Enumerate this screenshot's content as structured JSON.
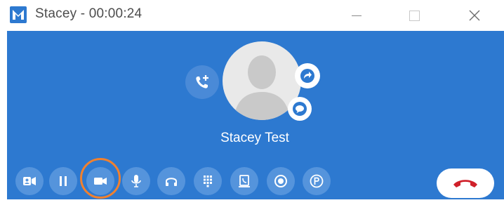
{
  "window": {
    "title": "Stacey - 00:00:24",
    "app_icon": "mitel-app-icon",
    "controls": [
      "minimize-icon",
      "maximize-icon",
      "close-icon"
    ]
  },
  "call": {
    "caller_name": "Stacey Test",
    "background_color": "#2d79d0",
    "accent_color": "#f0812f",
    "hangup_color": "#d0202a"
  },
  "avatar_actions": [
    "add-call-icon",
    "transfer-icon",
    "chat-icon"
  ],
  "controls": [
    {
      "name": "contact-card-button",
      "icon": "contact-card-icon"
    },
    {
      "name": "hold-button",
      "icon": "pause-icon"
    },
    {
      "name": "video-button",
      "icon": "video-camera-icon",
      "highlighted": true
    },
    {
      "name": "mute-button",
      "icon": "microphone-icon"
    },
    {
      "name": "audio-device-button",
      "icon": "headset-icon"
    },
    {
      "name": "keypad-button",
      "icon": "dialpad-icon"
    },
    {
      "name": "park-button",
      "icon": "phone-book-icon"
    },
    {
      "name": "record-button",
      "icon": "record-icon"
    },
    {
      "name": "park-call-button",
      "icon": "p-circle-icon"
    },
    {
      "name": "end-call-button",
      "icon": "hangup-icon"
    }
  ]
}
